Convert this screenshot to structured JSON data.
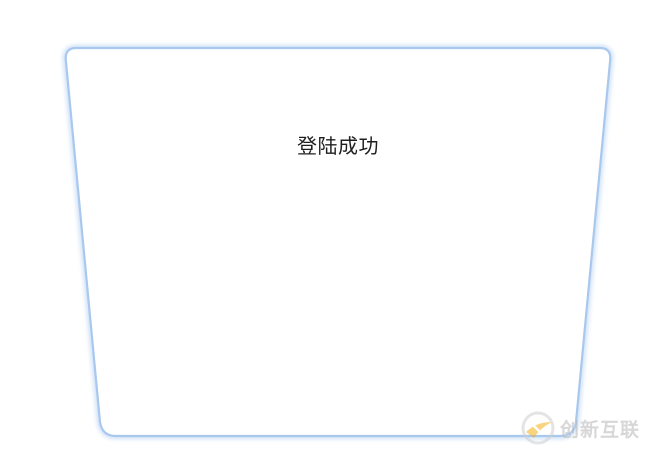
{
  "dialog": {
    "message": "登陆成功"
  },
  "watermark": {
    "icon": "chuangxin-logo-icon",
    "text": "创新互联"
  },
  "colors": {
    "panel_border": "#a9c8ee",
    "panel_glow": "#d6e6f8",
    "message_text": "#1f1f1f",
    "watermark_accent": "#f3b21b"
  }
}
